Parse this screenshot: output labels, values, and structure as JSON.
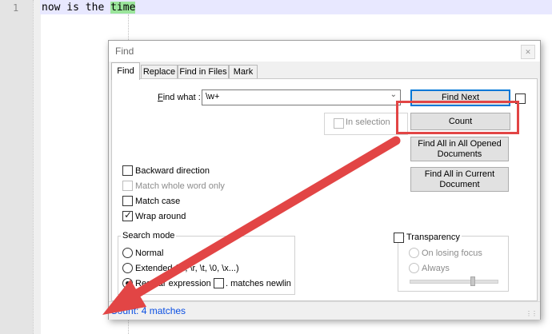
{
  "editor": {
    "line_number": "1",
    "text_before": "now is the ",
    "text_highlight": "time"
  },
  "dialog": {
    "title": "Find",
    "close_glyph": "✕",
    "tabs": [
      {
        "label": "Find",
        "active": true
      },
      {
        "label": "Replace",
        "active": false
      },
      {
        "label": "Find in Files",
        "active": false
      },
      {
        "label": "Mark",
        "active": false
      }
    ],
    "find_what": {
      "label_prefix": "F",
      "label_rest": "ind what :",
      "value": "\\w+"
    },
    "buttons": {
      "find_next": "Find Next",
      "count": "Count",
      "find_all_opened": "Find All in All Opened Documents",
      "find_all_current": "Find All in Current Document"
    },
    "in_selection": "In selection",
    "options": {
      "backward_direction": {
        "label": "Backward direction",
        "checked": false
      },
      "match_whole_word": {
        "label": "Match whole word only",
        "checked": false,
        "disabled": true
      },
      "match_case": {
        "label": "Match case",
        "checked": false
      },
      "wrap_around": {
        "label": "Wrap around",
        "checked": true
      }
    },
    "search_mode": {
      "title": "Search mode",
      "normal": "Normal",
      "extended": "Extended (\\n, \\r, \\t, \\0, \\x...)",
      "regex": "Regular expression",
      "matches_newline": ". matches newline",
      "selected": "regex"
    },
    "transparency": {
      "title": "Transparency",
      "on_losing_focus": "On losing focus",
      "always": "Always",
      "level": 0.7
    },
    "status": "Count: 4 matches"
  },
  "colors": {
    "highlight": "#9be59b",
    "annotation": "#e24545",
    "status_text": "#0a4fe3"
  }
}
